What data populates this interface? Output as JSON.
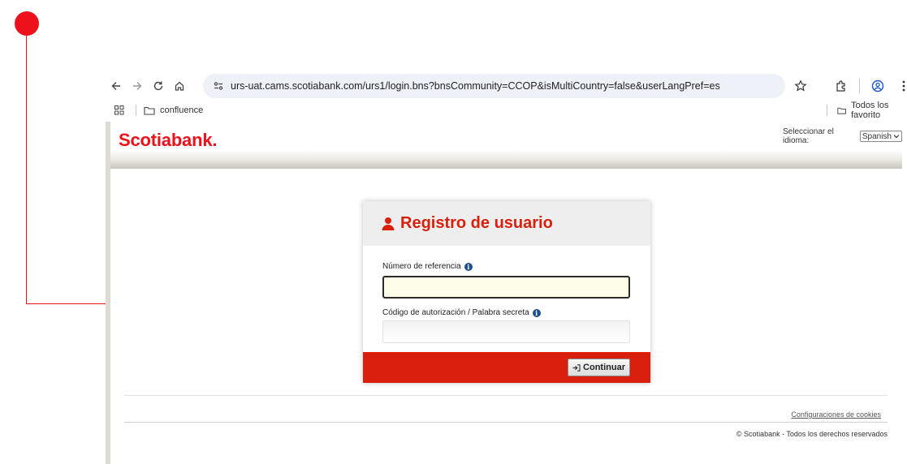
{
  "browser": {
    "url": "urs-uat.cams.scotiabank.com/urs1/login.bns?bnsCommunity=CCOP&isMultiCountry=false&userLangPref=es",
    "bookmarks": {
      "folder": "confluence",
      "all_bookmarks": "Todos los favorito"
    }
  },
  "header": {
    "logo": "Scotiabank.",
    "language_label": "Seleccionar el idioma:",
    "language_value": "Spanish"
  },
  "card": {
    "title": "Registro de usuario",
    "reference_label": "Número de referencia",
    "auth_label": "Código de autorización / Palabra secreta",
    "continue_label": "Continuar"
  },
  "footer": {
    "cookies_link": "Configuraciones de cookies",
    "copyright": "© Scotiabank - Todos los derechos reservados"
  },
  "colors": {
    "brand_red": "#ec111a",
    "card_red": "#d9200c",
    "annotation_red": "#ec111a"
  }
}
